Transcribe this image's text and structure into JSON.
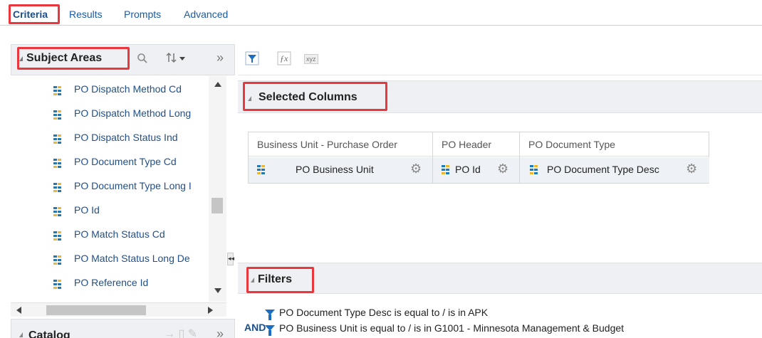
{
  "tabs": [
    {
      "label": "Criteria",
      "active": true
    },
    {
      "label": "Results"
    },
    {
      "label": "Prompts"
    },
    {
      "label": "Advanced"
    }
  ],
  "subject_areas": {
    "title": "Subject Areas",
    "header_icons": [
      "search-icon",
      "sort-icon",
      "expand-icon"
    ],
    "items": [
      {
        "label": "PO Dispatch Method Cd"
      },
      {
        "label": "PO Dispatch Method Long"
      },
      {
        "label": "PO Dispatch Status Ind"
      },
      {
        "label": "PO Document Type Cd"
      },
      {
        "label": "PO Document Type Long I"
      },
      {
        "label": "PO Id"
      },
      {
        "label": "PO Match Status Cd"
      },
      {
        "label": "PO Match Status Long De"
      },
      {
        "label": "PO Reference Id"
      }
    ]
  },
  "catalog": {
    "title": "Catalog"
  },
  "splitter_glyph": "◂◂",
  "toolbar_icons": [
    "filter-icon",
    "formula-icon",
    "xyz-icon"
  ],
  "toolbar_xyz_text": "xyz",
  "selected_columns": {
    "title": "Selected Columns",
    "columns": [
      {
        "group": "Business Unit - Purchase Order",
        "column": "PO Business Unit"
      },
      {
        "group": "PO Header",
        "column": "PO Id"
      },
      {
        "group": "PO Document Type",
        "column": "PO Document Type Desc"
      }
    ]
  },
  "filters": {
    "title": "Filters",
    "conjunction": "AND",
    "items": [
      {
        "text": "PO Document Type Desc is equal to / is in  APK"
      },
      {
        "text": "PO Business Unit is equal to / is in  G1001 - Minnesota Management & Budget"
      }
    ]
  },
  "colors": {
    "highlight": "#e8383d",
    "link": "#1a5aa6",
    "panel_header": "#eef0f3"
  }
}
